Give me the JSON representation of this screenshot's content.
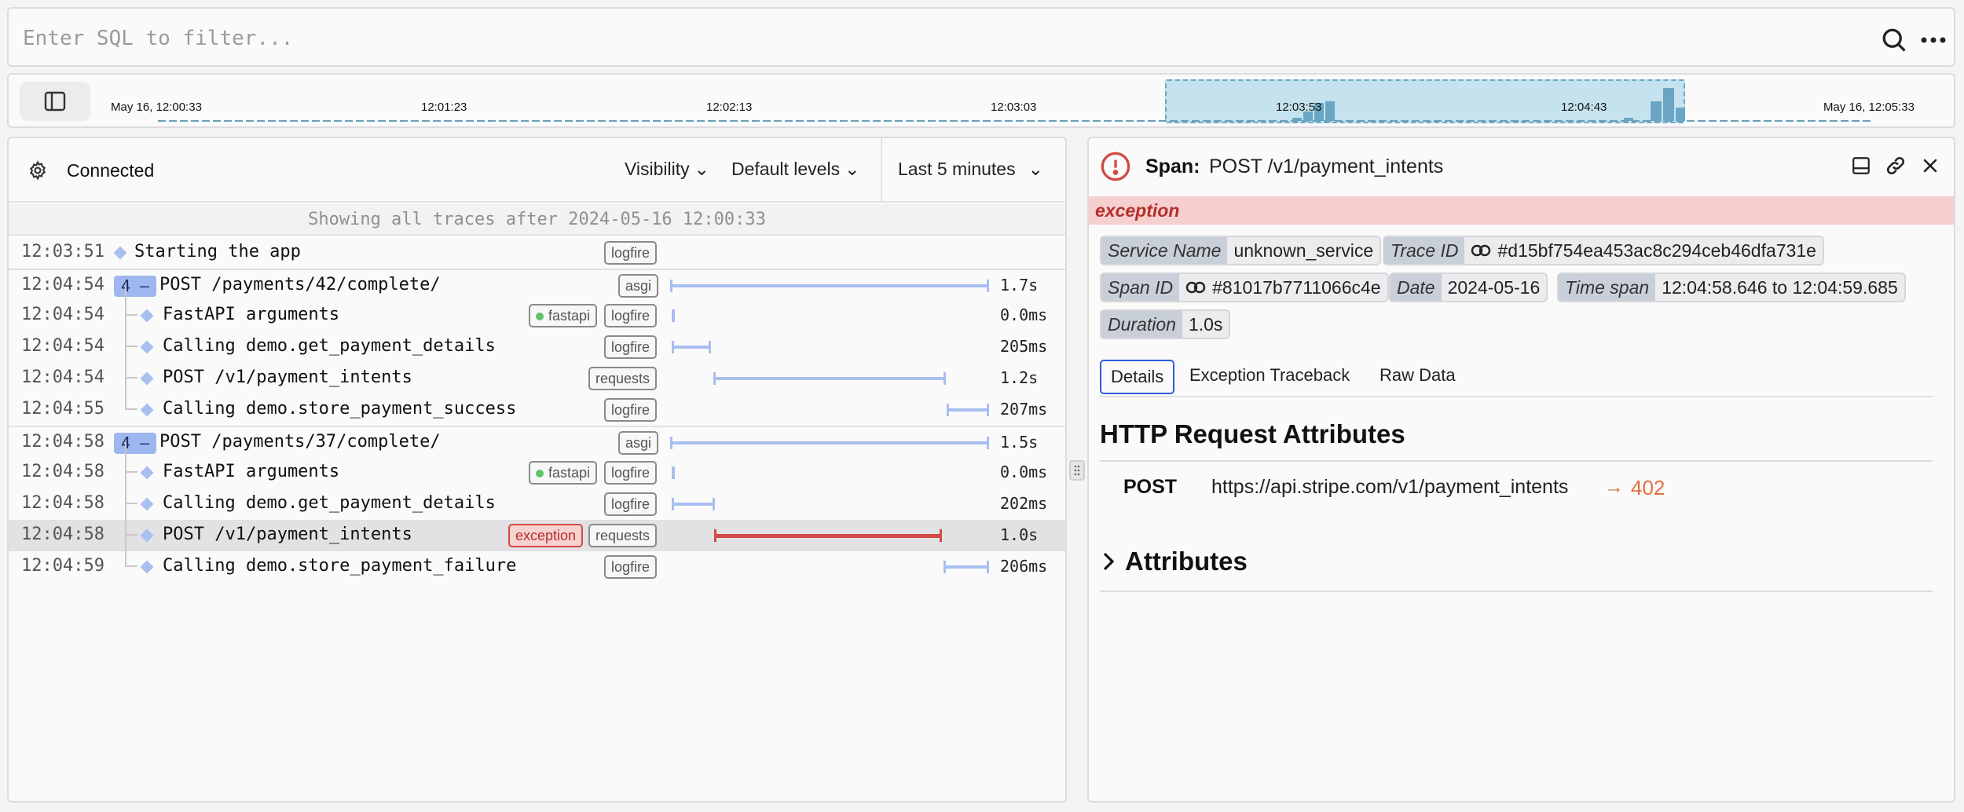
{
  "search": {
    "placeholder": "Enter SQL to filter..."
  },
  "timeline": {
    "ticks": [
      "May 16, 12:00:33",
      "12:01:23",
      "12:02:13",
      "12:03:03",
      "12:03:53",
      "12:04:43",
      "May 16, 12:05:33"
    ]
  },
  "left_panel": {
    "status": "Connected",
    "visibility_label": "Visibility",
    "levels_label": "Default levels",
    "range_label": "Last 5 minutes",
    "notice": "Showing all traces after 2024-05-16 12:00:33"
  },
  "rows": [
    {
      "time": "12:03:51",
      "name": "Starting the app",
      "tags": [
        "logfire"
      ],
      "duration": ""
    },
    {
      "time": "12:04:54",
      "count": "4 –",
      "name": "POST /payments/42/complete/",
      "tags": [
        "asgi"
      ],
      "duration": "1.7s"
    },
    {
      "time": "12:04:54",
      "name": "FastAPI arguments",
      "tags": [
        "fastapi",
        "logfire"
      ],
      "duration": "0.0ms"
    },
    {
      "time": "12:04:54",
      "name": "Calling demo.get_payment_details",
      "tags": [
        "logfire"
      ],
      "duration": "205ms"
    },
    {
      "time": "12:04:54",
      "name": "POST /v1/payment_intents",
      "tags": [
        "requests"
      ],
      "duration": "1.2s"
    },
    {
      "time": "12:04:55",
      "name": "Calling demo.store_payment_success",
      "tags": [
        "logfire"
      ],
      "duration": "207ms"
    },
    {
      "time": "12:04:58",
      "count": "4 –",
      "name": "POST /payments/37/complete/",
      "tags": [
        "asgi"
      ],
      "duration": "1.5s"
    },
    {
      "time": "12:04:58",
      "name": "FastAPI arguments",
      "tags": [
        "fastapi",
        "logfire"
      ],
      "duration": "0.0ms"
    },
    {
      "time": "12:04:58",
      "name": "Calling demo.get_payment_details",
      "tags": [
        "logfire"
      ],
      "duration": "202ms"
    },
    {
      "time": "12:04:58",
      "name": "POST /v1/payment_intents",
      "tags": [
        "exception",
        "requests"
      ],
      "duration": "1.0s"
    },
    {
      "time": "12:04:59",
      "name": "Calling demo.store_payment_failure",
      "tags": [
        "logfire"
      ],
      "duration": "206ms"
    }
  ],
  "span": {
    "title_label": "Span:",
    "title": "POST /v1/payment_intents",
    "level": "exception",
    "service_name_key": "Service Name",
    "service_name": "unknown_service",
    "trace_id_key": "Trace ID",
    "trace_id": "#d15bf754ea453ac8c294ceb46dfa731e",
    "span_id_key": "Span ID",
    "span_id": "#81017b7711066c4e",
    "date_key": "Date",
    "date": "2024-05-16",
    "time_span_key": "Time span",
    "time_span": "12:04:58.646 to 12:04:59.685",
    "duration_key": "Duration",
    "duration": "1.0s",
    "tabs": [
      "Details",
      "Exception Traceback",
      "Raw Data"
    ],
    "http_heading": "HTTP Request Attributes",
    "method": "POST",
    "url": "https://api.stripe.com/v1/payment_intents",
    "status_arrow": "→",
    "status": "402",
    "attributes_heading": "Attributes"
  },
  "colors": {
    "accent": "#2d5bd7",
    "bar": "#a8bff0",
    "error": "#d24a45",
    "timeline_sel": "#c4e3ee"
  }
}
